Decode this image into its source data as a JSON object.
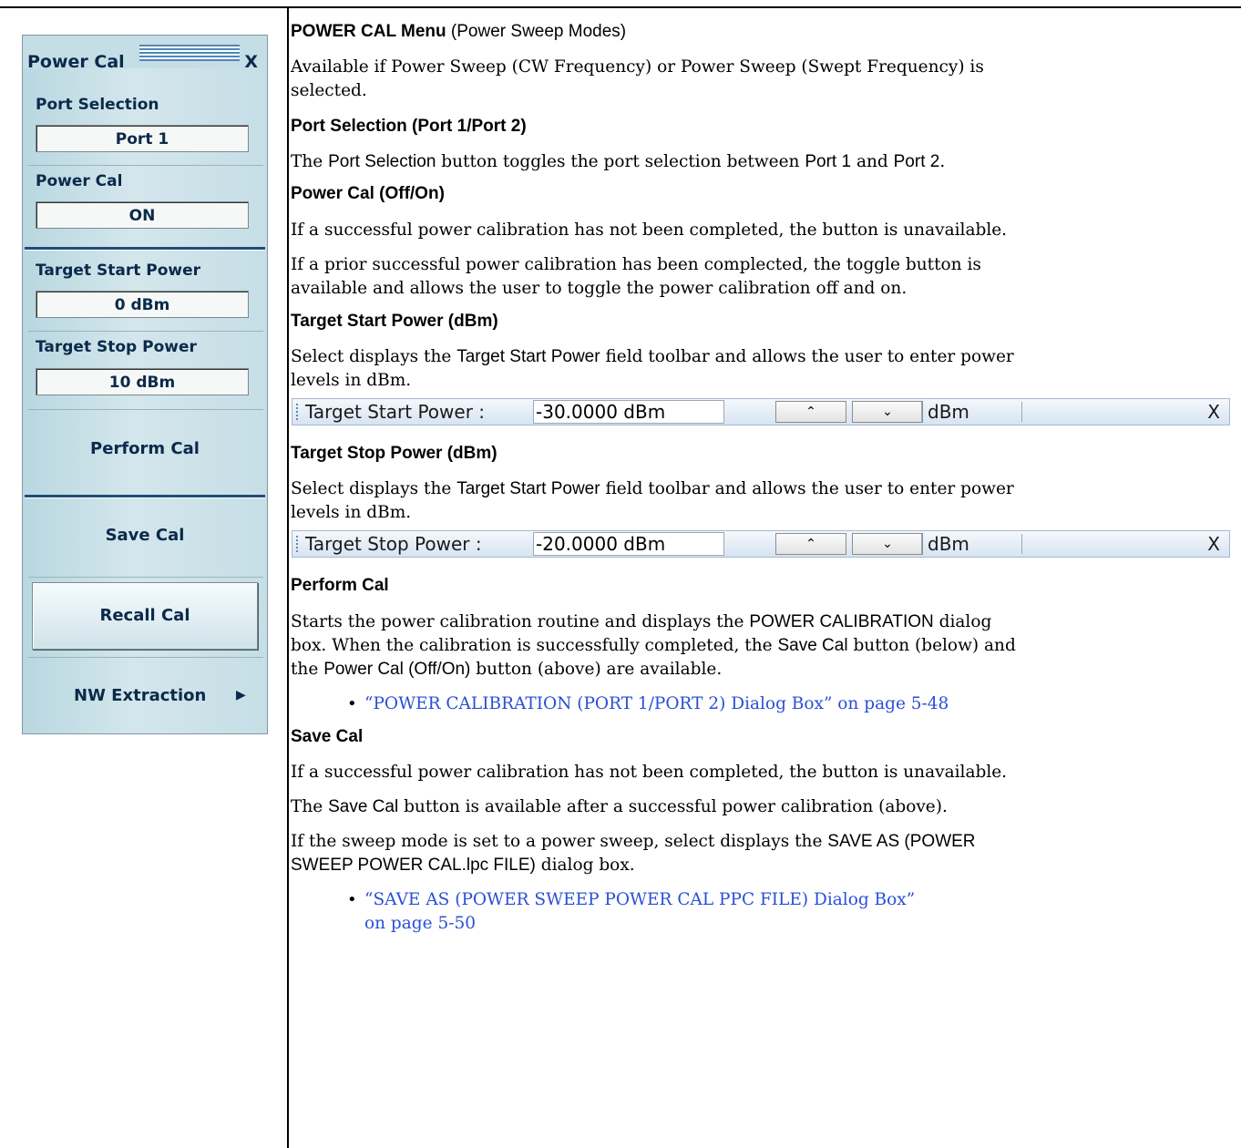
{
  "menu": {
    "title": "Power Cal",
    "close": "X",
    "port_selection_label": "Port Selection",
    "port_selection_value": "Port 1",
    "power_cal_label": "Power Cal",
    "power_cal_value": "ON",
    "target_start_label": "Target Start Power",
    "target_start_value": "0  dBm",
    "target_stop_label": "Target Stop Power",
    "target_stop_value": "10  dBm",
    "perform_cal": "Perform  Cal",
    "save_cal": "Save Cal",
    "recall_cal": "Recall Cal",
    "nw_extraction": "NW Extraction",
    "nw_arrow": "▶"
  },
  "doc": {
    "heading_main": "POWER CAL Menu",
    "heading_main_sub": " (Power Sweep Modes)",
    "intro_1": "Available if Power Sweep (CW Frequency) or Power Sweep (Swept Frequency) is",
    "intro_2": "selected.",
    "port_heading": "Port Selection (Port 1/Port 2)",
    "port_text": {
      "a": "The ",
      "b": "Port Selection",
      "c": " button toggles the port selection between ",
      "d": "Port 1",
      "e": " and ",
      "f": "Port 2",
      "g": "."
    },
    "powercal_heading": "Power Cal (Off/On)",
    "powercal_p1": "If a successful power calibration has not been completed, the button is unavailable.",
    "powercal_p2_1": "If a prior successful power calibration has been complected, the toggle button is",
    "powercal_p2_2": "available and allows the user to toggle the power calibration off and on.",
    "start_heading": "Target Start Power (dBm)",
    "start_text_1": {
      "a": "Select displays the ",
      "b": "Target Start Power",
      "c": " field toolbar and allows the user to enter power"
    },
    "start_text_2": "levels in dBm.",
    "stop_heading": "Target Stop Power (dBm)",
    "stop_text_1": {
      "a": "Select displays the ",
      "b": "Target Start Power",
      "c": " field toolbar and allows the user to enter power"
    },
    "stop_text_2": "levels in dBm.",
    "perform_heading": "Perform Cal",
    "perform_text_1": {
      "a": "Starts the power calibration routine and displays the ",
      "b": "POWER CALIBRATION",
      "c": " dialog"
    },
    "perform_text_2": {
      "a": "box. When the calibration is successfully completed, the ",
      "b": "Save Cal",
      "c": " button (below) and"
    },
    "perform_text_3": {
      "a": "the ",
      "b": "Power Cal (Off/On)",
      "c": " button (above) are available."
    },
    "perform_link": "“POWER CALIBRATION (PORT 1/PORT 2) Dialog Box” on page 5-48",
    "save_heading": "Save Cal",
    "save_p1": "If a successful power calibration has not been completed, the button is unavailable.",
    "save_p2": {
      "a": "The ",
      "b": "Save Cal",
      "c": " button is available after a successful power calibration (above)."
    },
    "save_p3_1": {
      "a": "If the sweep mode is set to a power sweep, select displays the ",
      "b": "SAVE AS (POWER"
    },
    "save_p3_2": "SWEEP POWER CAL.lpc FILE)",
    "save_p3_2b": " dialog box.",
    "save_link_1": "“SAVE AS (POWER SWEEP POWER CAL PPC FILE) Dialog Box”",
    "save_link_2": "on page 5-50",
    "bullet": "•"
  },
  "toolbar_start": {
    "label": "Target Start Power  :",
    "value": "-30.0000  dBm",
    "up": "⌃",
    "down": "⌄",
    "unit": "dBm",
    "close": "X"
  },
  "toolbar_stop": {
    "label": "Target Stop Power  :",
    "value": "-20.0000  dBm",
    "up": "⌃",
    "down": "⌄",
    "unit": "dBm",
    "close": "X"
  }
}
